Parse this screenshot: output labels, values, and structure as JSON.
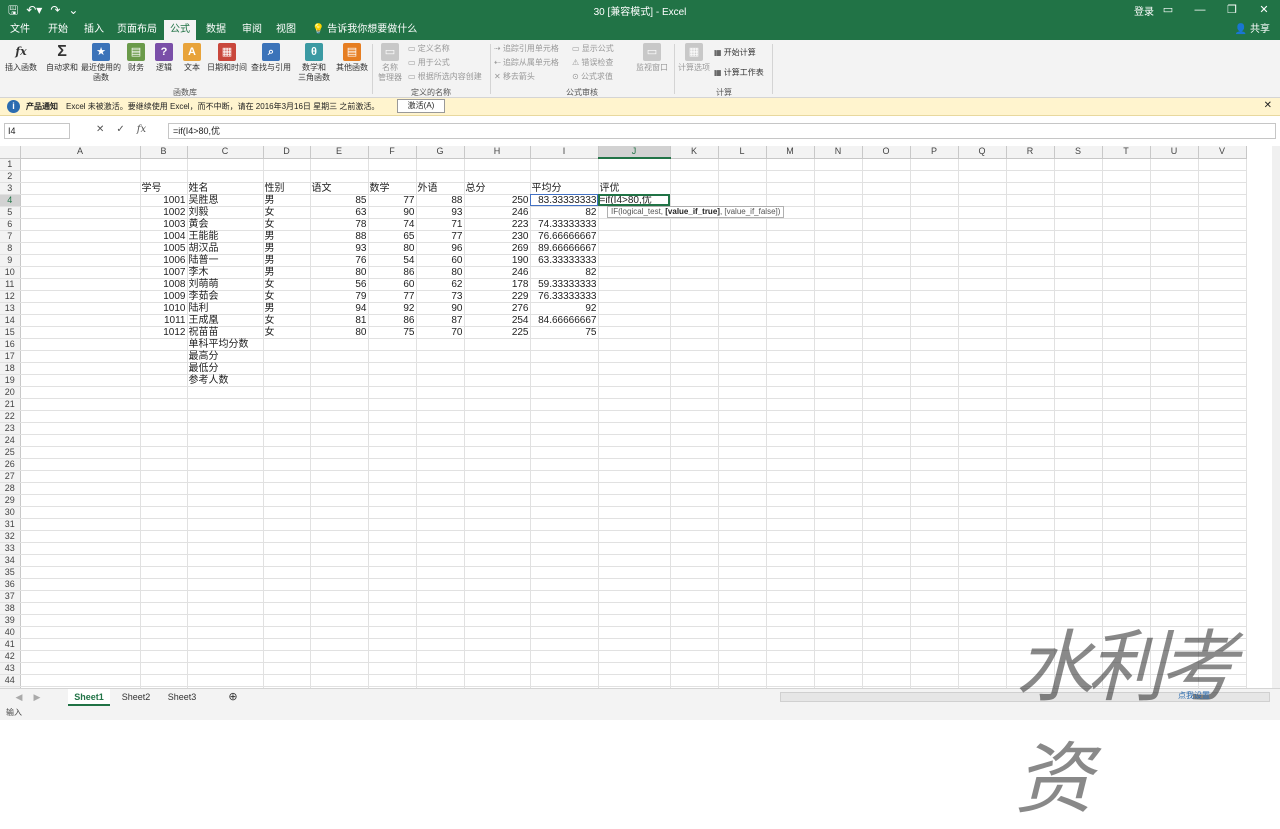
{
  "titlebar": {
    "title": "30 [兼容模式] - Excel",
    "login": "登录",
    "qat_icons": [
      "save-icon",
      "undo-icon",
      "redo-icon",
      "customize-icon"
    ]
  },
  "tabs": [
    {
      "label": "文件"
    },
    {
      "label": "开始"
    },
    {
      "label": "插入"
    },
    {
      "label": "页面布局"
    },
    {
      "label": "公式",
      "active": true
    },
    {
      "label": "数据"
    },
    {
      "label": "审阅"
    },
    {
      "label": "视图"
    }
  ],
  "tellme": "告诉我你想要做什么",
  "share": "共享",
  "ribbon": {
    "insert_function": "插入函数",
    "autosum": "自动求和",
    "recent": "最近使用的\n函数",
    "finance": "财务",
    "logical": "逻辑",
    "text": "文本",
    "datetime": "日期和时间",
    "lookup": "查找与引用",
    "math": "数学和\n三角函数",
    "more": "其他函数",
    "group_library": "函数库",
    "name_manager": "名称\n管理器",
    "define_name": "定义名称",
    "use_in_formula": "用于公式",
    "create_from_selection": "根据所选内容创建",
    "group_names": "定义的名称",
    "trace_precedents": "追踪引用单元格",
    "trace_dependents": "追踪从属单元格",
    "remove_arrows": "移去箭头",
    "show_formulas": "显示公式",
    "error_checking": "错误检查",
    "evaluate_formula": "公式求值",
    "group_audit": "公式审核",
    "watch_window": "监视窗口",
    "calc_options": "计算选项",
    "calc_now": "开始计算",
    "calc_sheet": "计算工作表",
    "group_calc": "计算"
  },
  "message": {
    "title": "产品通知",
    "text": "Excel 未被激活。要继续使用 Excel，而不中断，请在 2016年3月16日 星期三 之前激活。",
    "button": "激活(A)"
  },
  "formula_bar": {
    "name_box": "I4",
    "cancel": "✕",
    "enter": "✓",
    "fx": "fx",
    "formula": "=if(I4>80,优"
  },
  "columns": [
    "A",
    "B",
    "C",
    "D",
    "E",
    "F",
    "G",
    "H",
    "I",
    "J",
    "K",
    "L",
    "M",
    "N",
    "O",
    "P",
    "Q",
    "R",
    "S",
    "T",
    "U",
    "V"
  ],
  "headers": {
    "B": "学号",
    "C": "姓名",
    "D": "性别",
    "E": "语文",
    "F": "数学",
    "G": "外语",
    "H": "总分",
    "I": "平均分",
    "J": "评优"
  },
  "rows": [
    {
      "id": "1001",
      "name": "吴胜恩",
      "sex": "男",
      "chinese": "85",
      "math": "77",
      "english": "88",
      "total": "250",
      "avg": "83.33333333",
      "edit": "=if(I4>80,优"
    },
    {
      "id": "1002",
      "name": "刘毅",
      "sex": "女",
      "chinese": "63",
      "math": "90",
      "english": "93",
      "total": "246",
      "avg": "82"
    },
    {
      "id": "1003",
      "name": "黄会",
      "sex": "女",
      "chinese": "78",
      "math": "74",
      "english": "71",
      "total": "223",
      "avg": "74.33333333"
    },
    {
      "id": "1004",
      "name": "王能能",
      "sex": "男",
      "chinese": "88",
      "math": "65",
      "english": "77",
      "total": "230",
      "avg": "76.66666667"
    },
    {
      "id": "1005",
      "name": "胡汉品",
      "sex": "男",
      "chinese": "93",
      "math": "80",
      "english": "96",
      "total": "269",
      "avg": "89.66666667"
    },
    {
      "id": "1006",
      "name": "陆普一",
      "sex": "男",
      "chinese": "76",
      "math": "54",
      "english": "60",
      "total": "190",
      "avg": "63.33333333"
    },
    {
      "id": "1007",
      "name": "李木",
      "sex": "男",
      "chinese": "80",
      "math": "86",
      "english": "80",
      "total": "246",
      "avg": "82"
    },
    {
      "id": "1008",
      "name": "刘萌萌",
      "sex": "女",
      "chinese": "56",
      "math": "60",
      "english": "62",
      "total": "178",
      "avg": "59.33333333"
    },
    {
      "id": "1009",
      "name": "李茹会",
      "sex": "女",
      "chinese": "79",
      "math": "77",
      "english": "73",
      "total": "229",
      "avg": "76.33333333"
    },
    {
      "id": "1010",
      "name": "陆利",
      "sex": "男",
      "chinese": "94",
      "math": "92",
      "english": "90",
      "total": "276",
      "avg": "92"
    },
    {
      "id": "1011",
      "name": "王成凰",
      "sex": "女",
      "chinese": "81",
      "math": "86",
      "english": "87",
      "total": "254",
      "avg": "84.66666667"
    },
    {
      "id": "1012",
      "name": "祝苗苗",
      "sex": "女",
      "chinese": "80",
      "math": "75",
      "english": "70",
      "total": "225",
      "avg": "75"
    }
  ],
  "summary": [
    "单科平均分数",
    "最高分",
    "最低分",
    "参考人数"
  ],
  "tooltip": {
    "pre": "IF(logical_test, ",
    "bold": "[value_if_true]",
    "post": ", [value_if_false])"
  },
  "sheets": [
    "Sheet1",
    "Sheet2",
    "Sheet3"
  ],
  "status": "输入",
  "watermark": "水利考资",
  "wm_link": "点我设置"
}
